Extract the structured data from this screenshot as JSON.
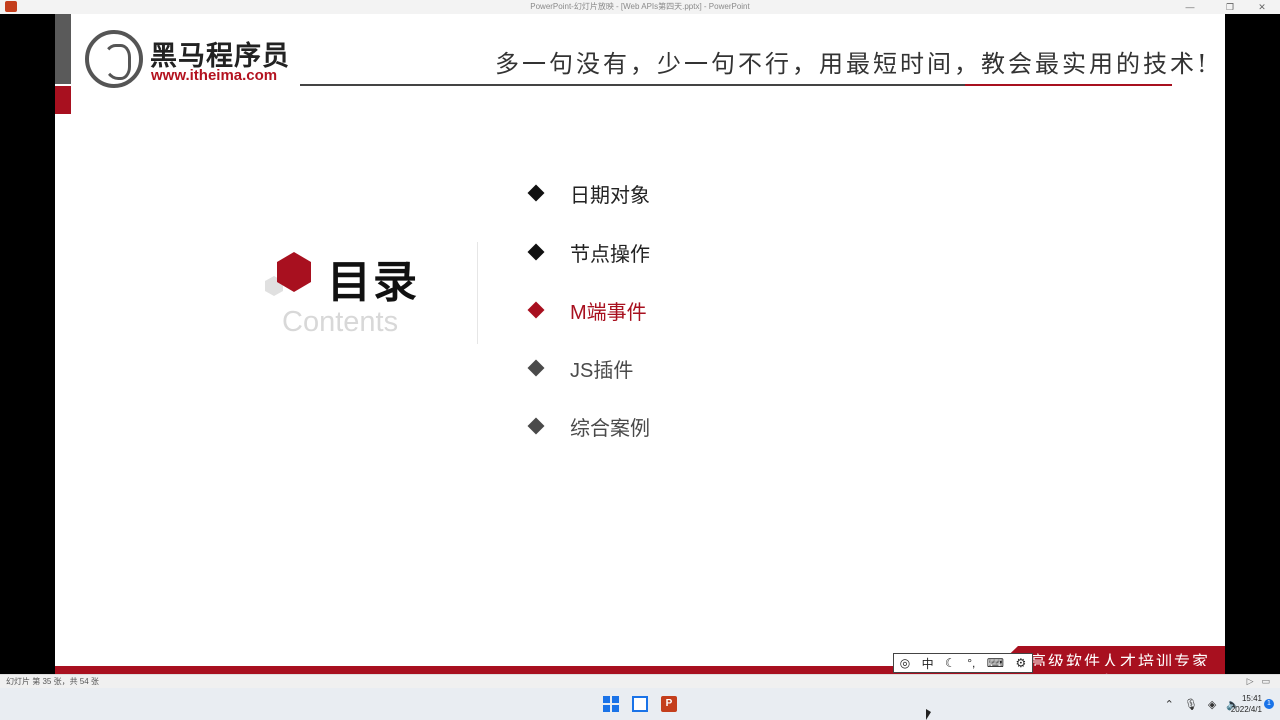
{
  "window": {
    "title": "PowerPoint-幻灯片放映 - [Web APIs第四天.pptx] - PowerPoint"
  },
  "slide": {
    "logo": {
      "name_cn": "黑马程序员",
      "url": "www.itheima.com"
    },
    "slogan": "多一句没有，少一句不行，用最短时间，教会最实用的技术!",
    "section_title": "目录",
    "section_subtitle": "Contents",
    "toc": [
      {
        "label": "日期对象",
        "state": "normal"
      },
      {
        "label": "节点操作",
        "state": "normal"
      },
      {
        "label": "M端事件",
        "state": "active"
      },
      {
        "label": "JS插件",
        "state": "muted"
      },
      {
        "label": "综合案例",
        "state": "muted"
      }
    ],
    "footer_tag": "高级软件人才培训专家",
    "colors": {
      "accent": "#a8101f",
      "text": "#222222"
    }
  },
  "ime_toolbar": {
    "mode": "中"
  },
  "watermark": "黑马程序员",
  "statusbar": {
    "slide_info": "幻灯片 第 35 张，共 54 张"
  },
  "taskbar": {
    "icons": [
      "windows-start-icon",
      "file-explorer-icon",
      "powerpoint-icon"
    ],
    "clock_time": "15:41",
    "clock_date": "2022/4/1",
    "notification_count": "1"
  }
}
